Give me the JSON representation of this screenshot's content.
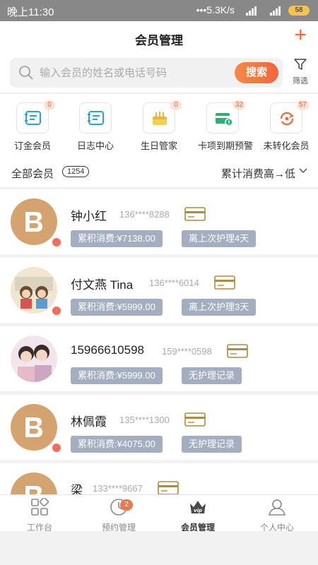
{
  "status_bar": {
    "time": "晚上11:30",
    "network": "•••5.3K/s",
    "battery": "58"
  },
  "header": {
    "title": "会员管理",
    "add_icon": "plus-icon",
    "accent_color": "#f0653a"
  },
  "search": {
    "placeholder": "输入会员的姓名或电话号码",
    "button_label": "搜索",
    "filter_label": "筛选"
  },
  "quick_menu": [
    {
      "label": "订金会员",
      "badge": "0",
      "icon": "deposit-note-icon"
    },
    {
      "label": "日志中心",
      "badge": "",
      "icon": "log-note-icon"
    },
    {
      "label": "生日管家",
      "badge": "0",
      "icon": "birthday-cake-icon"
    },
    {
      "label": "卡项到期预警",
      "badge": "32",
      "icon": "card-expiry-icon"
    },
    {
      "label": "未转化会员",
      "badge": "57",
      "icon": "conversion-icon"
    }
  ],
  "members_header": {
    "all_label": "全部会员",
    "count": "1254",
    "sort_label": "累计消费高→低"
  },
  "members": [
    {
      "name": "钟小红",
      "phone": "136****8288",
      "spend": "累积消费:¥7138.00",
      "care": "离上次护理4天",
      "avatar": "brand-logo"
    },
    {
      "name": "付文燕 Tina",
      "phone": "136****6014",
      "spend": "累积消费:¥5999.00",
      "care": "离上次护理3天",
      "avatar": "photo"
    },
    {
      "name": "15966610598",
      "phone": "159****0598",
      "spend": "累积消费:¥5999.00",
      "care": "无护理记录",
      "avatar": "photo"
    },
    {
      "name": "林佩霞",
      "phone": "135****1300",
      "spend": "累积消费:¥4075.00",
      "care": "无护理记录",
      "avatar": "brand-logo"
    },
    {
      "name": "梁",
      "phone": "133****9667",
      "spend": "",
      "care": "",
      "avatar": "brand-logo"
    }
  ],
  "bottom_nav": [
    {
      "label": "工作台",
      "icon": "workbench-grid-icon",
      "badge": ""
    },
    {
      "label": "预约管理",
      "icon": "appointment-clock-icon",
      "badge": "2"
    },
    {
      "label": "会员管理",
      "icon": "vip-crown-icon",
      "badge": "",
      "active": true
    },
    {
      "label": "个人中心",
      "icon": "user-profile-icon",
      "badge": ""
    }
  ]
}
